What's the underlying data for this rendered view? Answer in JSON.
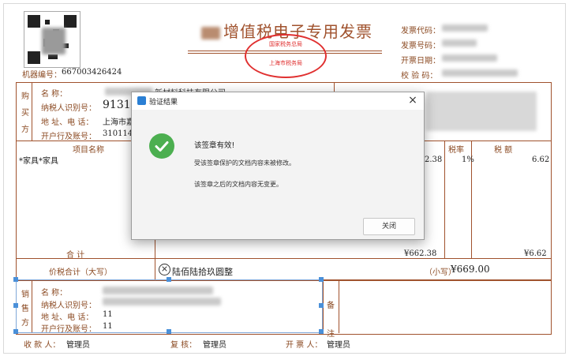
{
  "invoice": {
    "title": "增值税电子专用发票",
    "machine_no_label": "机器编号：",
    "machine_no": "667003426424",
    "header_right": {
      "code_label": "发票代码：",
      "number_label": "发票号码：",
      "date_label": "开票日期：",
      "check_label": "校 验 码："
    },
    "stamp": {
      "top": "国家税务总局",
      "bottom": "上海市税务局"
    },
    "buyer": {
      "side_label": [
        "购",
        "买",
        "方"
      ],
      "name_label": "名    称：",
      "name_value_suffix": "新材料科技有限公司",
      "tax_id_label": "纳税人识别号：",
      "tax_id_value": "91310",
      "address_label": "地 址、电 话：",
      "address_value": "上海市嘉",
      "bank_label": "开户行及账号：",
      "bank_value": "3101140"
    },
    "items_header": {
      "name": "项目名称",
      "tax_rate": "税率",
      "tax_amount": "税  额"
    },
    "items": [
      {
        "name": "*家具*家具",
        "amount": "2.38",
        "rate": "1%",
        "tax": "6.62"
      }
    ],
    "total_label": "合      计",
    "total_amount": "¥662.38",
    "total_tax": "¥6.62",
    "price_tax_label": "价税合计（大写）",
    "price_tax_words": "陆佰陆拾玖圆整",
    "small_label": "（小写）",
    "small_value": "¥669.00",
    "seller": {
      "side_label": [
        "销",
        "售",
        "方"
      ],
      "name_label": "名    称：",
      "tax_id_label": "纳税人识别号：",
      "address_label": "地 址、电 话：",
      "address_value": "11",
      "bank_label": "开户行及账号：",
      "bank_value": "11"
    },
    "remarks_label": [
      "备",
      "注"
    ],
    "footer": {
      "payee_label": "收 款 人：",
      "payee": "管理员",
      "reviewer_label": "复    核：",
      "reviewer": "管理员",
      "drawer_label": "开 票 人：",
      "drawer": "管理员"
    }
  },
  "dialog": {
    "title": "验证结果",
    "close_glyph": "×",
    "main_message": "该签章有效!",
    "line1": "受该签章保护的文档内容未被修改。",
    "line2": "该签章之后的文档内容无变更。",
    "close_button": "关闭"
  },
  "colors": {
    "invoice_brown": "#a0522d",
    "stamp_red": "#e03030",
    "success_green": "#4caf50",
    "selection_blue": "#4a90d9"
  }
}
